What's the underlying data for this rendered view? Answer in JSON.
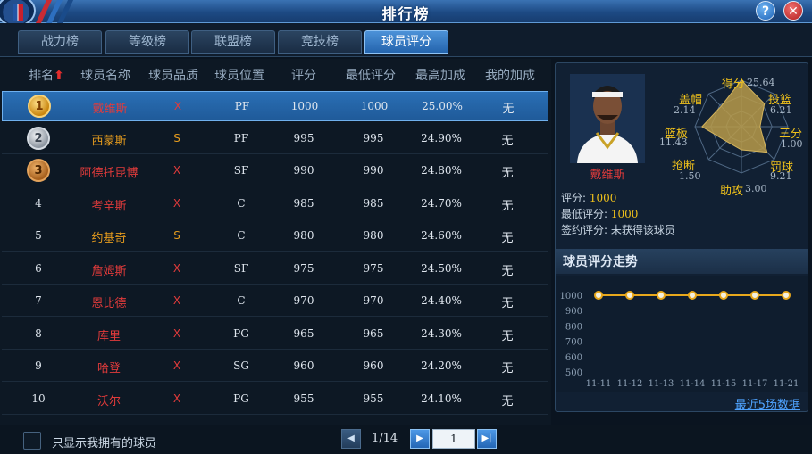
{
  "window": {
    "title": "排行榜"
  },
  "tabs": [
    {
      "label": "战力榜",
      "active": false
    },
    {
      "label": "等级榜",
      "active": false
    },
    {
      "label": "联盟榜",
      "active": false
    },
    {
      "label": "竞技榜",
      "active": false
    },
    {
      "label": "球员评分",
      "active": true
    }
  ],
  "table": {
    "headers": [
      "排名",
      "球员名称",
      "球员品质",
      "球员位置",
      "评分",
      "最低评分",
      "最高加成",
      "我的加成"
    ],
    "rows": [
      {
        "rank": "1",
        "name": "戴维斯",
        "quality": "X",
        "pos": "PF",
        "score": "1000",
        "min": "1000",
        "bonus_max": "25.00%",
        "my_bonus": "无"
      },
      {
        "rank": "2",
        "name": "西蒙斯",
        "quality": "S",
        "pos": "PF",
        "score": "995",
        "min": "995",
        "bonus_max": "24.90%",
        "my_bonus": "无"
      },
      {
        "rank": "3",
        "name": "阿德托昆博",
        "quality": "X",
        "pos": "SF",
        "score": "990",
        "min": "990",
        "bonus_max": "24.80%",
        "my_bonus": "无"
      },
      {
        "rank": "4",
        "name": "考辛斯",
        "quality": "X",
        "pos": "C",
        "score": "985",
        "min": "985",
        "bonus_max": "24.70%",
        "my_bonus": "无"
      },
      {
        "rank": "5",
        "name": "约基奇",
        "quality": "S",
        "pos": "C",
        "score": "980",
        "min": "980",
        "bonus_max": "24.60%",
        "my_bonus": "无"
      },
      {
        "rank": "6",
        "name": "詹姆斯",
        "quality": "X",
        "pos": "SF",
        "score": "975",
        "min": "975",
        "bonus_max": "24.50%",
        "my_bonus": "无"
      },
      {
        "rank": "7",
        "name": "恩比德",
        "quality": "X",
        "pos": "C",
        "score": "970",
        "min": "970",
        "bonus_max": "24.40%",
        "my_bonus": "无"
      },
      {
        "rank": "8",
        "name": "库里",
        "quality": "X",
        "pos": "PG",
        "score": "965",
        "min": "965",
        "bonus_max": "24.30%",
        "my_bonus": "无"
      },
      {
        "rank": "9",
        "name": "哈登",
        "quality": "X",
        "pos": "SG",
        "score": "960",
        "min": "960",
        "bonus_max": "24.20%",
        "my_bonus": "无"
      },
      {
        "rank": "10",
        "name": "沃尔",
        "quality": "X",
        "pos": "PG",
        "score": "955",
        "min": "955",
        "bonus_max": "24.10%",
        "my_bonus": "无"
      }
    ]
  },
  "player_card": {
    "name": "戴维斯",
    "score_label": "评分: ",
    "score": "1000",
    "min_label": "最低评分: ",
    "min": "1000",
    "sign_label": "签约评分: ",
    "sign": "未获得该球员",
    "radar": [
      {
        "label": "得分",
        "value": "25.64",
        "frac": 1.0
      },
      {
        "label": "投篮",
        "value": "6.21",
        "frac": 0.7
      },
      {
        "label": "三分",
        "value": "1.00",
        "frac": 0.4
      },
      {
        "label": "罚球",
        "value": "9.21",
        "frac": 0.78
      },
      {
        "label": "助攻",
        "value": "3.00",
        "frac": 0.5
      },
      {
        "label": "抢断",
        "value": "1.50",
        "frac": 0.45
      },
      {
        "label": "篮板",
        "value": "11.43",
        "frac": 0.85
      },
      {
        "label": "盖帽",
        "value": "2.14",
        "frac": 0.62
      }
    ]
  },
  "trend": {
    "heading": "球员评分走势",
    "link": "最近5场数据",
    "chart_data": {
      "type": "line",
      "x": [
        "11-11",
        "11-12",
        "11-13",
        "11-14",
        "11-15",
        "11-17",
        "11-21"
      ],
      "y": [
        1000,
        1000,
        1000,
        1000,
        1000,
        1000,
        1000
      ],
      "yticks": [
        "1000",
        "900",
        "800",
        "700",
        "600",
        "500"
      ],
      "ylim": [
        500,
        1000
      ],
      "line_color": "#e8a81c"
    }
  },
  "footer": {
    "checkbox_label": "只显示我拥有的球员",
    "page_text": "1/14",
    "page_input": "1"
  },
  "colors": {
    "quality_X": "#e23b3b",
    "quality_S": "#e39a1e",
    "accent": "#f1c21b"
  }
}
